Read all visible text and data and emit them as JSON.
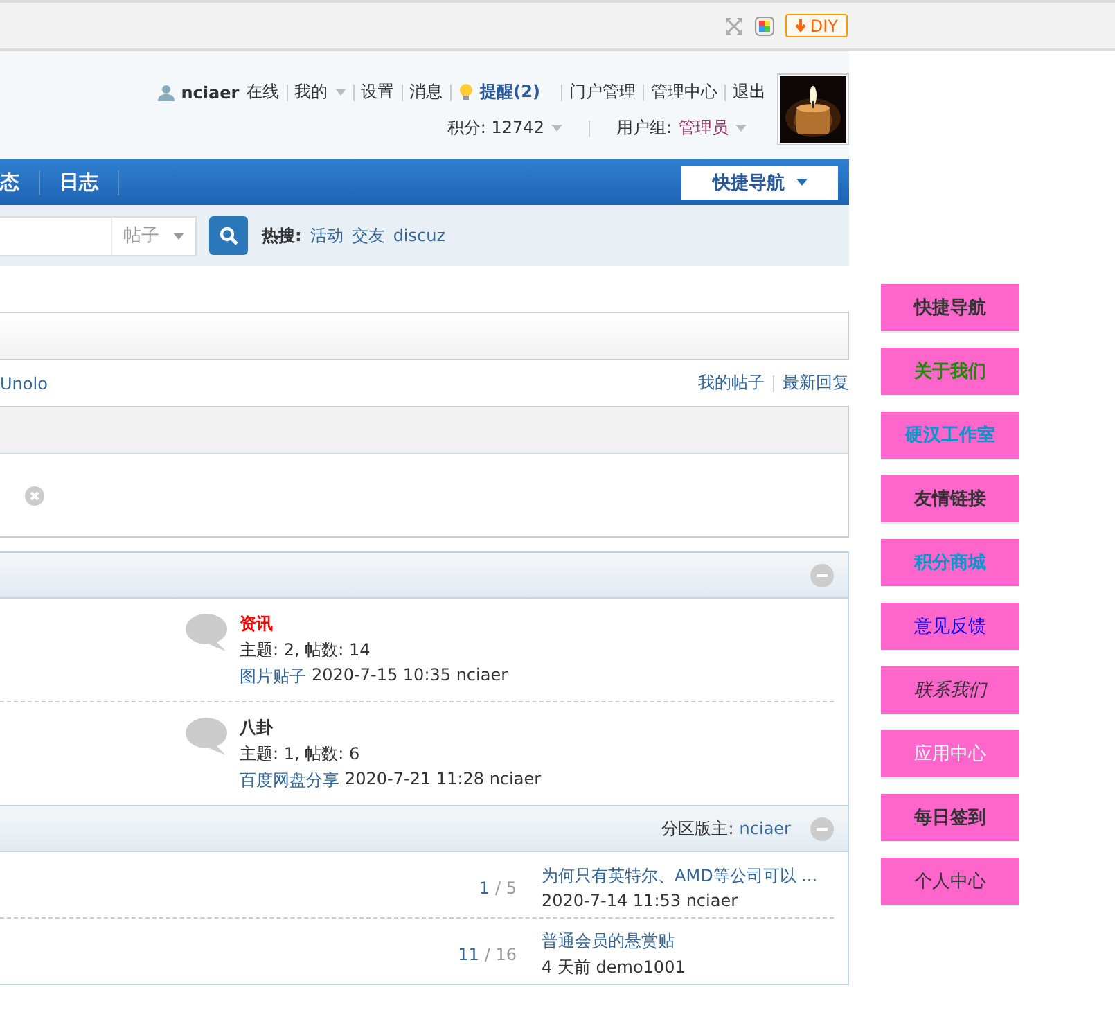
{
  "toolbar": {
    "diy_label": "DIY"
  },
  "user_bar": {
    "username": "nciaer",
    "status": "在线",
    "links": [
      {
        "label": "我的",
        "kind": "menu"
      },
      {
        "label": "设置",
        "kind": "link"
      },
      {
        "label": "消息",
        "kind": "link"
      },
      {
        "label": "提醒(2)",
        "kind": "notice"
      },
      {
        "label": "门户管理",
        "kind": "link"
      },
      {
        "label": "管理中心",
        "kind": "link"
      },
      {
        "label": "退出",
        "kind": "link"
      }
    ],
    "credits": "积分: 12742",
    "group_label": "用户组:",
    "group_value": "管理员"
  },
  "nav": {
    "items": [
      {
        "label": "态"
      },
      {
        "label": "日志"
      }
    ],
    "quick_nav": "快捷导航"
  },
  "search": {
    "type_select": "帖子",
    "hot_label": "热搜:",
    "hot_links": [
      "活动",
      "交友",
      "discuz"
    ]
  },
  "breadcrumb": "Unolo",
  "post_links": [
    "我的帖子",
    "最新回复"
  ],
  "forum_category": {
    "forums": [
      {
        "name": "资讯",
        "color": "#ff0000",
        "stats": "主题: 2, 帖数: 14",
        "last_post_title": "图片贴子",
        "last_post_meta": "2020-7-15 10:35 nciaer"
      },
      {
        "name": "八卦",
        "color": "#333333",
        "stats": "主题: 1, 帖数: 6",
        "last_post_title": "百度网盘分享",
        "last_post_meta": "2020-7-21 11:28 nciaer"
      }
    ]
  },
  "thread_category": {
    "moderator_label": "分区版主:",
    "moderator": "nciaer",
    "threads": [
      {
        "replies": "1",
        "views": "/ 5",
        "title": "为何只有英特尔、AMD等公司可以 ...",
        "meta": "2020-7-14 11:53 nciaer"
      },
      {
        "replies": "11",
        "views": "/ 16",
        "title": "普通会员的悬赏贴",
        "meta": "4 天前 demo1001"
      }
    ]
  },
  "float_menu": [
    {
      "label": "快捷导航",
      "kind": "strong"
    },
    {
      "label": "关于我们",
      "kind": "green"
    },
    {
      "label": "硬汉工作室",
      "kind": "cyan"
    },
    {
      "label": "友情链接",
      "kind": "strong"
    },
    {
      "label": "积分商城",
      "kind": "cyan"
    },
    {
      "label": "意见反馈",
      "kind": "blue"
    },
    {
      "label": "联系我们",
      "kind": "italic"
    },
    {
      "label": "应用中心",
      "kind": "light"
    },
    {
      "label": "每日签到",
      "kind": "strong"
    },
    {
      "label": "个人中心",
      "kind": "plain"
    }
  ]
}
